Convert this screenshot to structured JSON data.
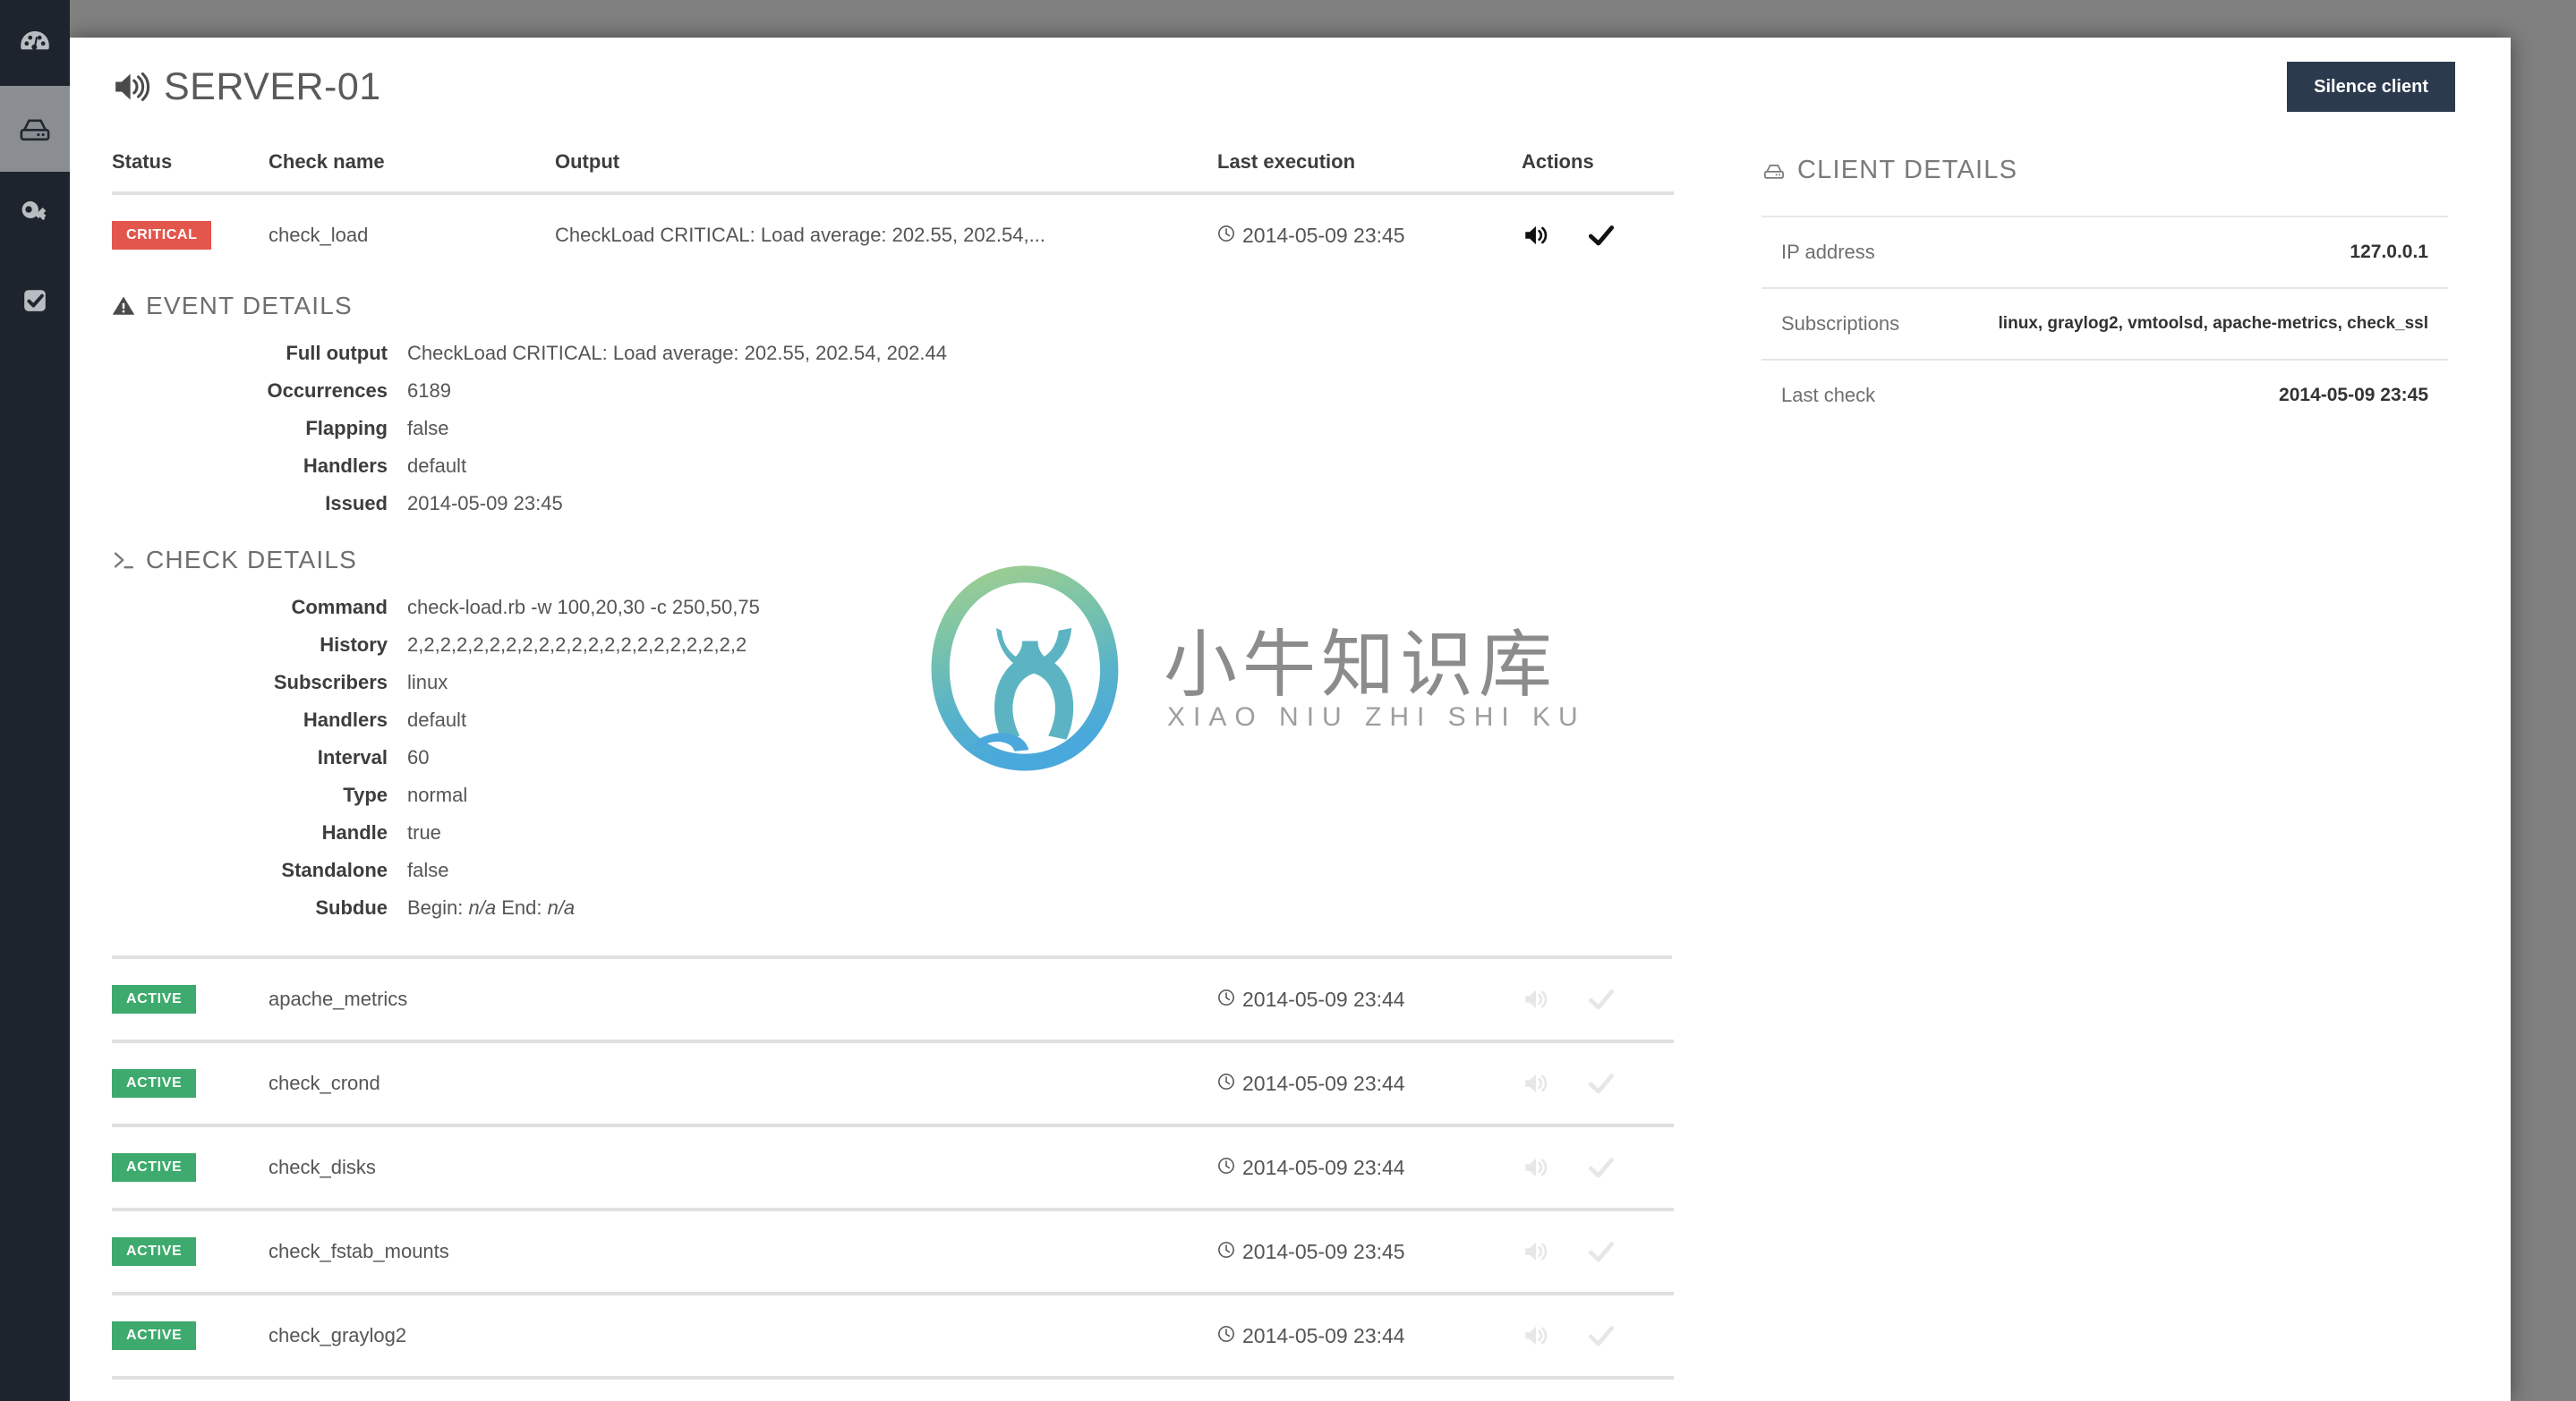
{
  "colors": {
    "rail_bg": "#1e242e",
    "rail_active": "#8a8e93",
    "critical": "#e3564c",
    "active": "#3eaa6d",
    "button": "#2c3a4d",
    "page_bg": "#808080"
  },
  "rail": {
    "items": [
      {
        "icon": "dashboard-gauge-icon",
        "name": "dashboard",
        "active": false
      },
      {
        "icon": "server-icon",
        "name": "clients",
        "active": true
      },
      {
        "icon": "key-icon",
        "name": "api-keys",
        "active": false
      },
      {
        "icon": "check-square-icon",
        "name": "checks",
        "active": false
      }
    ]
  },
  "header": {
    "icon": "speaker-icon",
    "title": "SERVER-01",
    "silence_button": "Silence client"
  },
  "checks_table": {
    "columns": [
      "Status",
      "Check name",
      "Output",
      "Last execution",
      "Actions"
    ],
    "rows": [
      {
        "status": "CRITICAL",
        "status_kind": "critical",
        "name": "check_load",
        "output": "CheckLoad CRITICAL: Load average: 202.55, 202.54,...",
        "last_execution": "2014-05-09 23:45",
        "actions": [
          "speaker-icon",
          "check-icon"
        ],
        "actions_dim": false
      },
      {
        "status": "ACTIVE",
        "status_kind": "active",
        "name": "apache_metrics",
        "output": "",
        "last_execution": "2014-05-09 23:44",
        "actions": [
          "speaker-icon",
          "check-icon"
        ],
        "actions_dim": true
      },
      {
        "status": "ACTIVE",
        "status_kind": "active",
        "name": "check_crond",
        "output": "",
        "last_execution": "2014-05-09 23:44",
        "actions": [
          "speaker-icon",
          "check-icon"
        ],
        "actions_dim": true
      },
      {
        "status": "ACTIVE",
        "status_kind": "active",
        "name": "check_disks",
        "output": "",
        "last_execution": "2014-05-09 23:44",
        "actions": [
          "speaker-icon",
          "check-icon"
        ],
        "actions_dim": true
      },
      {
        "status": "ACTIVE",
        "status_kind": "active",
        "name": "check_fstab_mounts",
        "output": "",
        "last_execution": "2014-05-09 23:45",
        "actions": [
          "speaker-icon",
          "check-icon"
        ],
        "actions_dim": true
      },
      {
        "status": "ACTIVE",
        "status_kind": "active",
        "name": "check_graylog2",
        "output": "",
        "last_execution": "2014-05-09 23:44",
        "actions": [
          "speaker-icon",
          "check-icon"
        ],
        "actions_dim": true
      }
    ]
  },
  "event_details": {
    "icon": "warning-triangle-icon",
    "title": "EVENT DETAILS",
    "fields": [
      {
        "label": "Full output",
        "value": "CheckLoad CRITICAL: Load average: 202.55, 202.54, 202.44"
      },
      {
        "label": "Occurrences",
        "value": "6189"
      },
      {
        "label": "Flapping",
        "value": "false"
      },
      {
        "label": "Handlers",
        "value": "default"
      },
      {
        "label": "Issued",
        "value": "2014-05-09 23:45"
      }
    ]
  },
  "check_details": {
    "icon": "terminal-prompt-icon",
    "title": "CHECK DETAILS",
    "fields": [
      {
        "label": "Command",
        "value": "check-load.rb -w 100,20,30 -c 250,50,75"
      },
      {
        "label": "History",
        "value": "2,2,2,2,2,2,2,2,2,2,2,2,2,2,2,2,2,2,2,2,2"
      },
      {
        "label": "Subscribers",
        "value": "linux"
      },
      {
        "label": "Handlers",
        "value": "default"
      },
      {
        "label": "Interval",
        "value": "60"
      },
      {
        "label": "Type",
        "value": "normal"
      },
      {
        "label": "Handle",
        "value": "true"
      },
      {
        "label": "Standalone",
        "value": "false"
      },
      {
        "label": "Subdue",
        "value": "Begin: n/a End: n/a",
        "subdue": true,
        "begin_label": "Begin:",
        "begin_value": "n/a",
        "end_label": "End:",
        "end_value": "n/a"
      }
    ]
  },
  "client_details": {
    "icon": "server-icon",
    "title": "CLIENT DETAILS",
    "rows": [
      {
        "label": "IP address",
        "value": "127.0.0.1",
        "small": false
      },
      {
        "label": "Subscriptions",
        "value": "linux, graylog2, vmtoolsd, apache-metrics, check_ssl",
        "small": true
      },
      {
        "label": "Last check",
        "value": "2014-05-09 23:45",
        "small": false
      }
    ]
  },
  "watermark": {
    "cn": "小牛知识库",
    "en": "XIAO NIU ZHI SHI KU"
  }
}
